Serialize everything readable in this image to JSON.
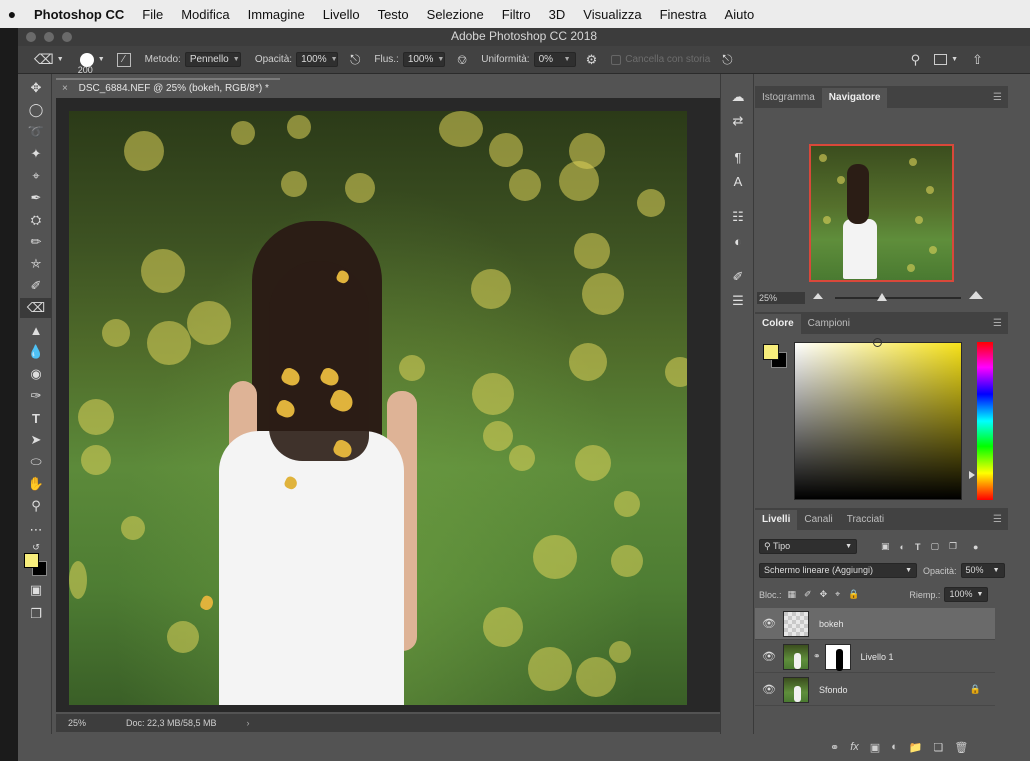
{
  "menubar": {
    "app": "Photoshop CC",
    "items": [
      "File",
      "Modifica",
      "Immagine",
      "Livello",
      "Testo",
      "Selezione",
      "Filtro",
      "3D",
      "Visualizza",
      "Finestra",
      "Aiuto"
    ]
  },
  "window": {
    "title": "Adobe Photoshop CC 2018"
  },
  "options": {
    "brush_size": "200",
    "metodo_label": "Metodo:",
    "metodo_value": "Pennello",
    "opacita_label": "Opacità:",
    "opacita_value": "100%",
    "flusso_label": "Flus.:",
    "flusso_value": "100%",
    "uniformita_label": "Uniformità:",
    "uniformita_value": "0%",
    "cancella_label": "Cancella con storia"
  },
  "document": {
    "tab_title": "DSC_6884.NEF @ 25% (bokeh, RGB/8*) *",
    "status_zoom": "25%",
    "status_doc": "Doc: 22,3 MB/58,5 MB"
  },
  "navigator": {
    "tabs": [
      "Istogramma",
      "Navigatore"
    ],
    "zoom": "25%"
  },
  "color": {
    "tabs": [
      "Colore",
      "Campioni"
    ],
    "foreground": "#f8ee7c",
    "background": "#000000"
  },
  "layers": {
    "tabs": [
      "Livelli",
      "Canali",
      "Tracciati"
    ],
    "filter": "Tipo",
    "blend_mode": "Schermo lineare (Aggiungi)",
    "opacity_label": "Opacità:",
    "opacity_value": "50%",
    "lock_label": "Bloc.:",
    "fill_label": "Riemp.:",
    "fill_value": "100%",
    "items": [
      {
        "name": "bokeh",
        "selected": true
      },
      {
        "name": "Livello 1",
        "selected": false
      },
      {
        "name": "Sfondo",
        "selected": false
      }
    ]
  }
}
